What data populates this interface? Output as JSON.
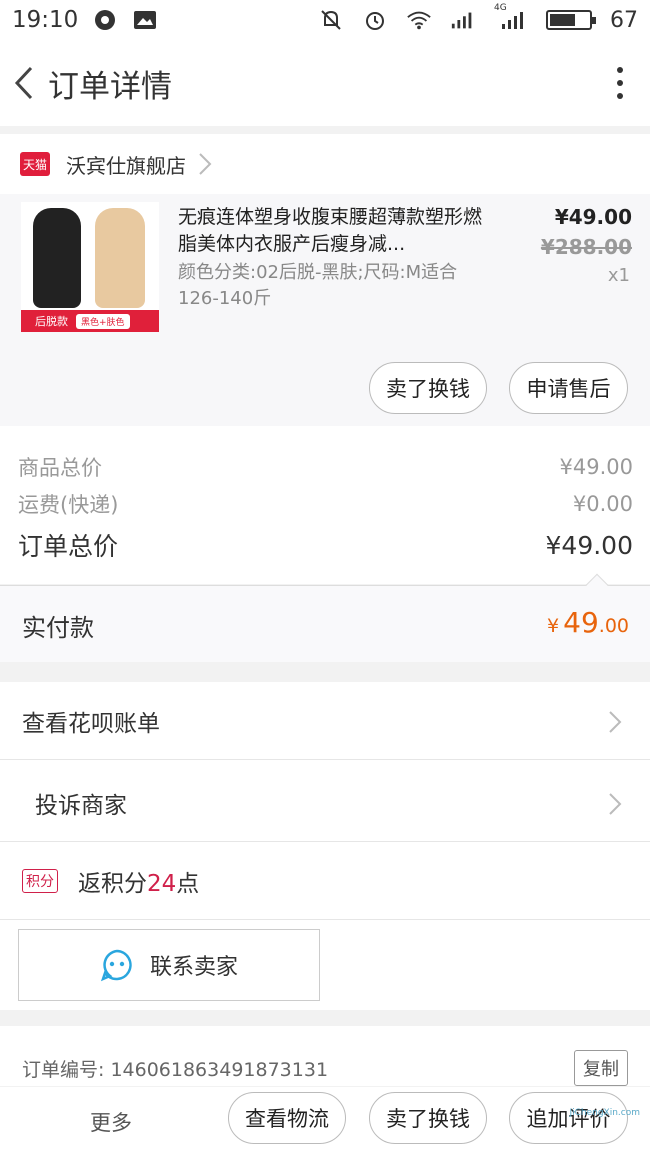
{
  "status_bar": {
    "time": "19:10",
    "network": "4G",
    "battery": "67",
    "battery_level": 0.67
  },
  "header": {
    "title": "订单详情"
  },
  "shop": {
    "badge": "天猫",
    "name": "沃宾仕旗舰店"
  },
  "item": {
    "title": "无痕连体塑身收腹束腰超薄款塑形燃脂美体内衣服产后瘦身减...",
    "spec": "颜色分类:02后脱-黑肤;尺码:M适合126-140斤",
    "price": "¥49.00",
    "original_price": "¥288.00",
    "quantity": "x1",
    "thumb_label": "后脱款",
    "thumb_tag": "黑色+肤色",
    "buttons": [
      "卖了换钱",
      "申请售后"
    ]
  },
  "totals": {
    "goods_label": "商品总价",
    "goods_value": "¥49.00",
    "shipping_label": "运费(快递)",
    "shipping_value": "¥0.00",
    "order_label": "订单总价",
    "order_value": "¥49.00"
  },
  "paid": {
    "label": "实付款",
    "currency": "¥",
    "integer": "49",
    "decimal": ".00"
  },
  "menu": {
    "huabei": "查看花呗账单",
    "complain": "投诉商家"
  },
  "points": {
    "badge": "积分",
    "prefix": "返积分",
    "value": "24",
    "suffix": "点"
  },
  "contact": {
    "label": "联系卖家"
  },
  "order_info": {
    "number_label": "订单编号: 146061863491873131",
    "copy_label": "复制"
  },
  "bottom_bar": {
    "more": "更多",
    "buttons": [
      "查看物流",
      "卖了换钱",
      "追加评价"
    ]
  },
  "watermark": "JiChengXin.com",
  "colors": {
    "accent": "#e8640c",
    "tmall_red": "#e01e3c",
    "points_red": "#d0204a"
  }
}
